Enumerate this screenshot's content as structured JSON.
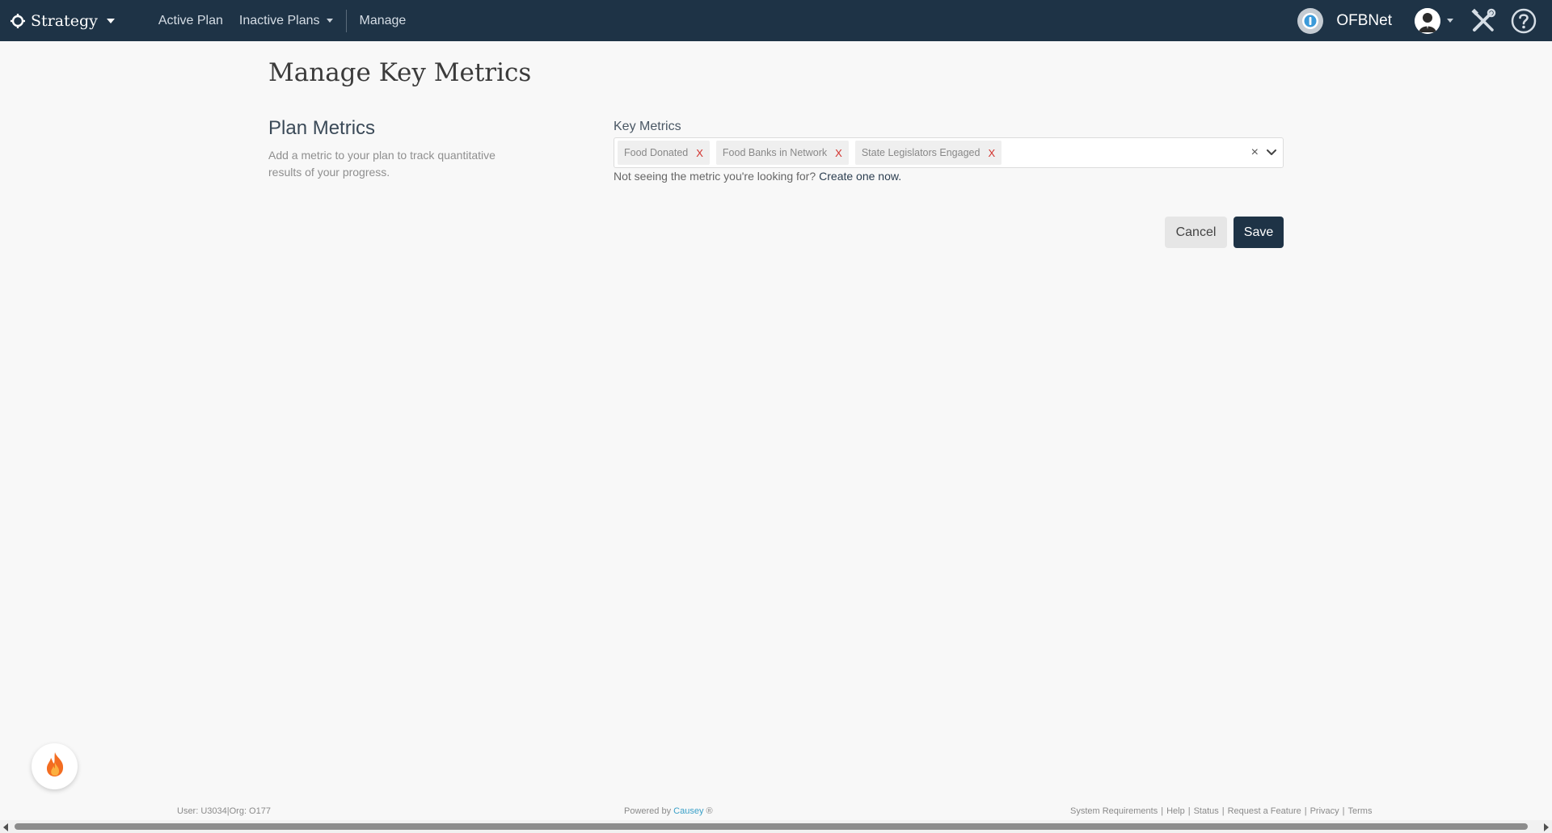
{
  "navbar": {
    "brand_label": "Strategy",
    "links": [
      {
        "label": "Active Plan"
      },
      {
        "label": "Inactive Plans"
      },
      {
        "label": "Manage"
      }
    ],
    "org_name": "OFBNet",
    "icons": {
      "brand": "crosshair-icon",
      "org": "org-logo-icon",
      "avatar": "user-avatar-icon",
      "tools": "tools-icon",
      "help": "help-circle-icon"
    }
  },
  "page": {
    "title": "Manage Key Metrics"
  },
  "plan_metrics": {
    "title": "Plan Metrics",
    "description": "Add a metric to your plan to track quantitative results of your progress."
  },
  "key_metrics": {
    "label": "Key Metrics",
    "selected": [
      {
        "label": "Food Donated",
        "remove": "X"
      },
      {
        "label": "Food Banks in Network",
        "remove": "X"
      },
      {
        "label": "State Legislators Engaged",
        "remove": "X"
      }
    ],
    "clear_all": "×",
    "helper_text": "Not seeing the metric you're looking for?",
    "helper_link": "Create one now."
  },
  "actions": {
    "cancel_label": "Cancel",
    "save_label": "Save"
  },
  "footer": {
    "user_info": "User: U3034|Org: O177",
    "powered_by": "Powered by",
    "powered_brand": "Causey",
    "registered": "®",
    "links": [
      {
        "label": "System Requirements"
      },
      {
        "label": "Help"
      },
      {
        "label": "Status"
      },
      {
        "label": "Request a Feature"
      },
      {
        "label": "Privacy"
      },
      {
        "label": "Terms"
      }
    ],
    "separator": "|"
  },
  "colors": {
    "navbar": "#1e3346",
    "save_button": "#1e3346",
    "chip_remove": "#d2322d",
    "footer_brand": "#3aa0c8"
  }
}
